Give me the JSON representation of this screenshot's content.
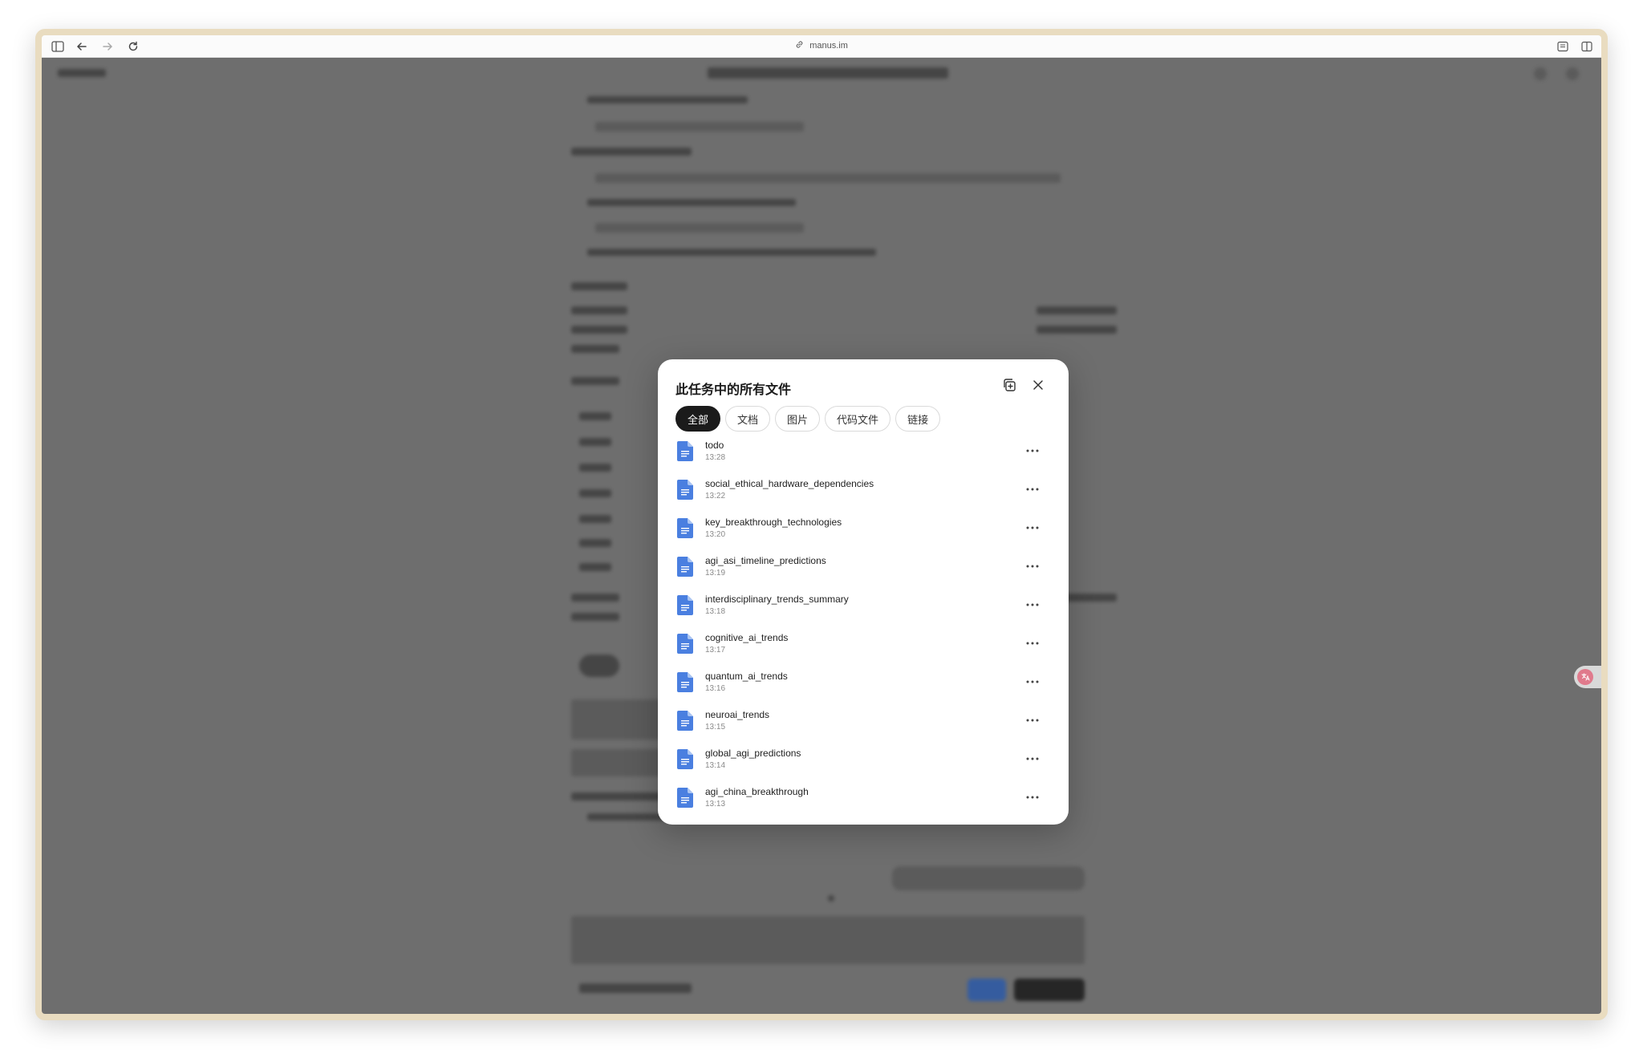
{
  "browser": {
    "url": "manus.im"
  },
  "modal": {
    "title": "此任务中的所有文件",
    "tabs": [
      {
        "label": "全部",
        "active": true
      },
      {
        "label": "文档",
        "active": false
      },
      {
        "label": "图片",
        "active": false
      },
      {
        "label": "代码文件",
        "active": false
      },
      {
        "label": "链接",
        "active": false
      }
    ],
    "files": [
      {
        "name": "todo",
        "time": "13:28"
      },
      {
        "name": "social_ethical_hardware_dependencies",
        "time": "13:22"
      },
      {
        "name": "key_breakthrough_technologies",
        "time": "13:20"
      },
      {
        "name": "agi_asi_timeline_predictions",
        "time": "13:19"
      },
      {
        "name": "interdisciplinary_trends_summary",
        "time": "13:18"
      },
      {
        "name": "cognitive_ai_trends",
        "time": "13:17"
      },
      {
        "name": "quantum_ai_trends",
        "time": "13:16"
      },
      {
        "name": "neuroai_trends",
        "time": "13:15"
      },
      {
        "name": "global_agi_predictions",
        "time": "13:14"
      },
      {
        "name": "agi_china_breakthrough",
        "time": "13:13"
      }
    ]
  },
  "colors": {
    "overlay": "#6e6e6e",
    "file_icon": "#4a7fe0",
    "active_tab": "#1b1b1b",
    "window_frame": "#e9dcc0"
  },
  "icons": {
    "sidebar": "sidebar-icon",
    "back": "arrow-left-icon",
    "forward": "arrow-right-icon",
    "reload": "reload-icon",
    "link": "link-icon",
    "reader": "reader-icon",
    "split": "split-view-icon",
    "add_files": "add-files-icon",
    "close": "close-icon",
    "file": "document-icon",
    "more": "more-icon"
  }
}
